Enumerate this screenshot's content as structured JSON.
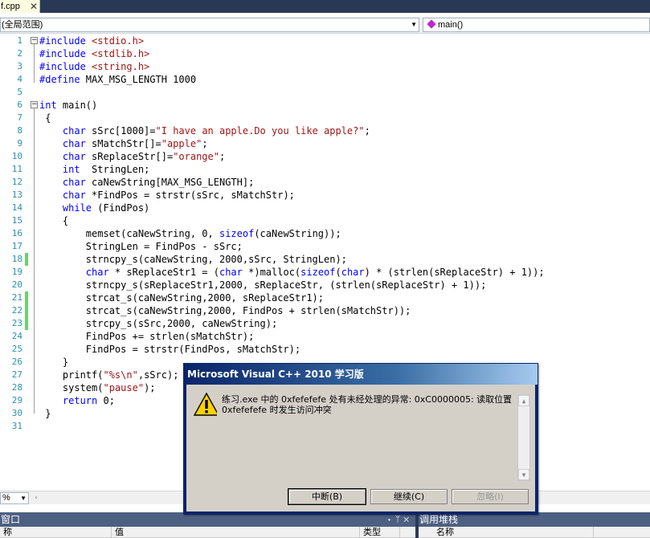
{
  "tab": {
    "label": "f.cpp",
    "close": "✕"
  },
  "nav": {
    "scope": "(全局范围)",
    "member": "main()"
  },
  "code_lines": [
    {
      "n": "1",
      "parts": [
        [
          "pp",
          "#include "
        ],
        [
          "str",
          "<stdio.h>"
        ]
      ]
    },
    {
      "n": "2",
      "parts": [
        [
          "pp",
          "#include "
        ],
        [
          "str",
          "<stdlib.h>"
        ]
      ]
    },
    {
      "n": "3",
      "parts": [
        [
          "pp",
          "#include "
        ],
        [
          "str",
          "<string.h>"
        ]
      ]
    },
    {
      "n": "4",
      "parts": [
        [
          "pp",
          "#define "
        ],
        [
          "",
          "MAX_MSG_LENGTH 1000"
        ]
      ]
    },
    {
      "n": "5",
      "parts": []
    },
    {
      "n": "6",
      "parts": [
        [
          "kw",
          "int"
        ],
        [
          "",
          " main()"
        ]
      ]
    },
    {
      "n": "7",
      "parts": [
        [
          "",
          " {"
        ]
      ]
    },
    {
      "n": "8",
      "parts": [
        [
          "",
          "    "
        ],
        [
          "kw",
          "char"
        ],
        [
          "",
          " sSrc[1000]="
        ],
        [
          "str",
          "\"I have an apple.Do you like apple?\""
        ],
        [
          "",
          ";"
        ]
      ]
    },
    {
      "n": "9",
      "parts": [
        [
          "",
          "    "
        ],
        [
          "kw",
          "char"
        ],
        [
          "",
          " sMatchStr[]="
        ],
        [
          "str",
          "\"apple\""
        ],
        [
          "",
          ";"
        ]
      ]
    },
    {
      "n": "10",
      "parts": [
        [
          "",
          "    "
        ],
        [
          "kw",
          "char"
        ],
        [
          "",
          " sReplaceStr[]="
        ],
        [
          "str",
          "\"orange\""
        ],
        [
          "",
          ";"
        ]
      ]
    },
    {
      "n": "11",
      "parts": [
        [
          "",
          "    "
        ],
        [
          "kw",
          "int"
        ],
        [
          "",
          "  StringLen;"
        ]
      ]
    },
    {
      "n": "12",
      "parts": [
        [
          "",
          "    "
        ],
        [
          "kw",
          "char"
        ],
        [
          "",
          " caNewString[MAX_MSG_LENGTH];"
        ]
      ]
    },
    {
      "n": "13",
      "parts": [
        [
          "",
          "    "
        ],
        [
          "kw",
          "char"
        ],
        [
          "",
          " *FindPos = strstr(sSrc, sMatchStr);"
        ]
      ]
    },
    {
      "n": "14",
      "parts": [
        [
          "",
          "    "
        ],
        [
          "kw",
          "while"
        ],
        [
          "",
          " (FindPos)"
        ]
      ]
    },
    {
      "n": "15",
      "parts": [
        [
          "",
          "    {"
        ]
      ]
    },
    {
      "n": "16",
      "parts": [
        [
          "",
          "        memset(caNewString, 0, "
        ],
        [
          "kw",
          "sizeof"
        ],
        [
          "",
          "(caNewString));"
        ]
      ]
    },
    {
      "n": "17",
      "parts": [
        [
          "",
          "        StringLen = FindPos - sSrc;"
        ]
      ]
    },
    {
      "n": "18",
      "parts": [
        [
          "",
          "        strncpy_s(caNewString, 2000,sSrc, StringLen);"
        ]
      ],
      "chg": true
    },
    {
      "n": "19",
      "parts": [
        [
          "",
          "        "
        ],
        [
          "kw",
          "char"
        ],
        [
          "",
          " * sReplaceStr1 = ("
        ],
        [
          "kw",
          "char"
        ],
        [
          "",
          " *)malloc("
        ],
        [
          "kw",
          "sizeof"
        ],
        [
          "",
          "("
        ],
        [
          "kw",
          "char"
        ],
        [
          "",
          ") * (strlen(sReplaceStr) + 1));"
        ]
      ]
    },
    {
      "n": "20",
      "parts": [
        [
          "",
          "        strncpy_s(sReplaceStr1,2000, sReplaceStr, (strlen(sReplaceStr) + 1));"
        ]
      ]
    },
    {
      "n": "21",
      "parts": [
        [
          "",
          "        strcat_s(caNewString,2000, sReplaceStr1);"
        ]
      ],
      "chg": true
    },
    {
      "n": "22",
      "parts": [
        [
          "",
          "        strcat_s(caNewString,2000, FindPos + strlen(sMatchStr));"
        ]
      ],
      "chg": true
    },
    {
      "n": "23",
      "parts": [
        [
          "",
          "        strcpy_s(sSrc,2000, caNewString);"
        ]
      ],
      "chg": true
    },
    {
      "n": "24",
      "parts": [
        [
          "",
          "        FindPos += strlen(sMatchStr);"
        ]
      ]
    },
    {
      "n": "25",
      "parts": [
        [
          "",
          "        FindPos = strstr(FindPos, sMatchStr);"
        ]
      ]
    },
    {
      "n": "26",
      "parts": [
        [
          "",
          "    }"
        ]
      ]
    },
    {
      "n": "27",
      "parts": [
        [
          "",
          "    printf("
        ],
        [
          "str",
          "\"%s\\n\""
        ],
        [
          "",
          ",sSrc);"
        ]
      ]
    },
    {
      "n": "28",
      "parts": [
        [
          "",
          "    system("
        ],
        [
          "str",
          "\"pause\""
        ],
        [
          "",
          ");"
        ]
      ]
    },
    {
      "n": "29",
      "parts": [
        [
          "",
          "    "
        ],
        [
          "kw",
          "return"
        ],
        [
          "",
          " 0;"
        ]
      ]
    },
    {
      "n": "30",
      "parts": [
        [
          "",
          " }"
        ]
      ]
    },
    {
      "n": "31",
      "parts": []
    }
  ],
  "zoom": {
    "value": "%"
  },
  "bottom": {
    "left_title": "窗口",
    "left_cols": [
      "称",
      "值",
      "类型"
    ],
    "right_title": "调用堆栈",
    "right_cols": [
      "名称"
    ]
  },
  "dialog": {
    "title": "Microsoft Visual C++ 2010 学习版",
    "message": "练习.exe 中的 0xfefefefe 处有未经处理的异常: 0xC0000005: 读取位置 0xfefefefe 时发生访问冲突",
    "buttons": {
      "break": "中断(B)",
      "continue": "继续(C)",
      "ignore": "忽略(I)"
    }
  },
  "colors": {
    "keyword": "#0000ff",
    "string": "#a31515",
    "line_number": "#2b91af",
    "change_marker": "#6cd36c",
    "title_bar": "#0a246a"
  }
}
